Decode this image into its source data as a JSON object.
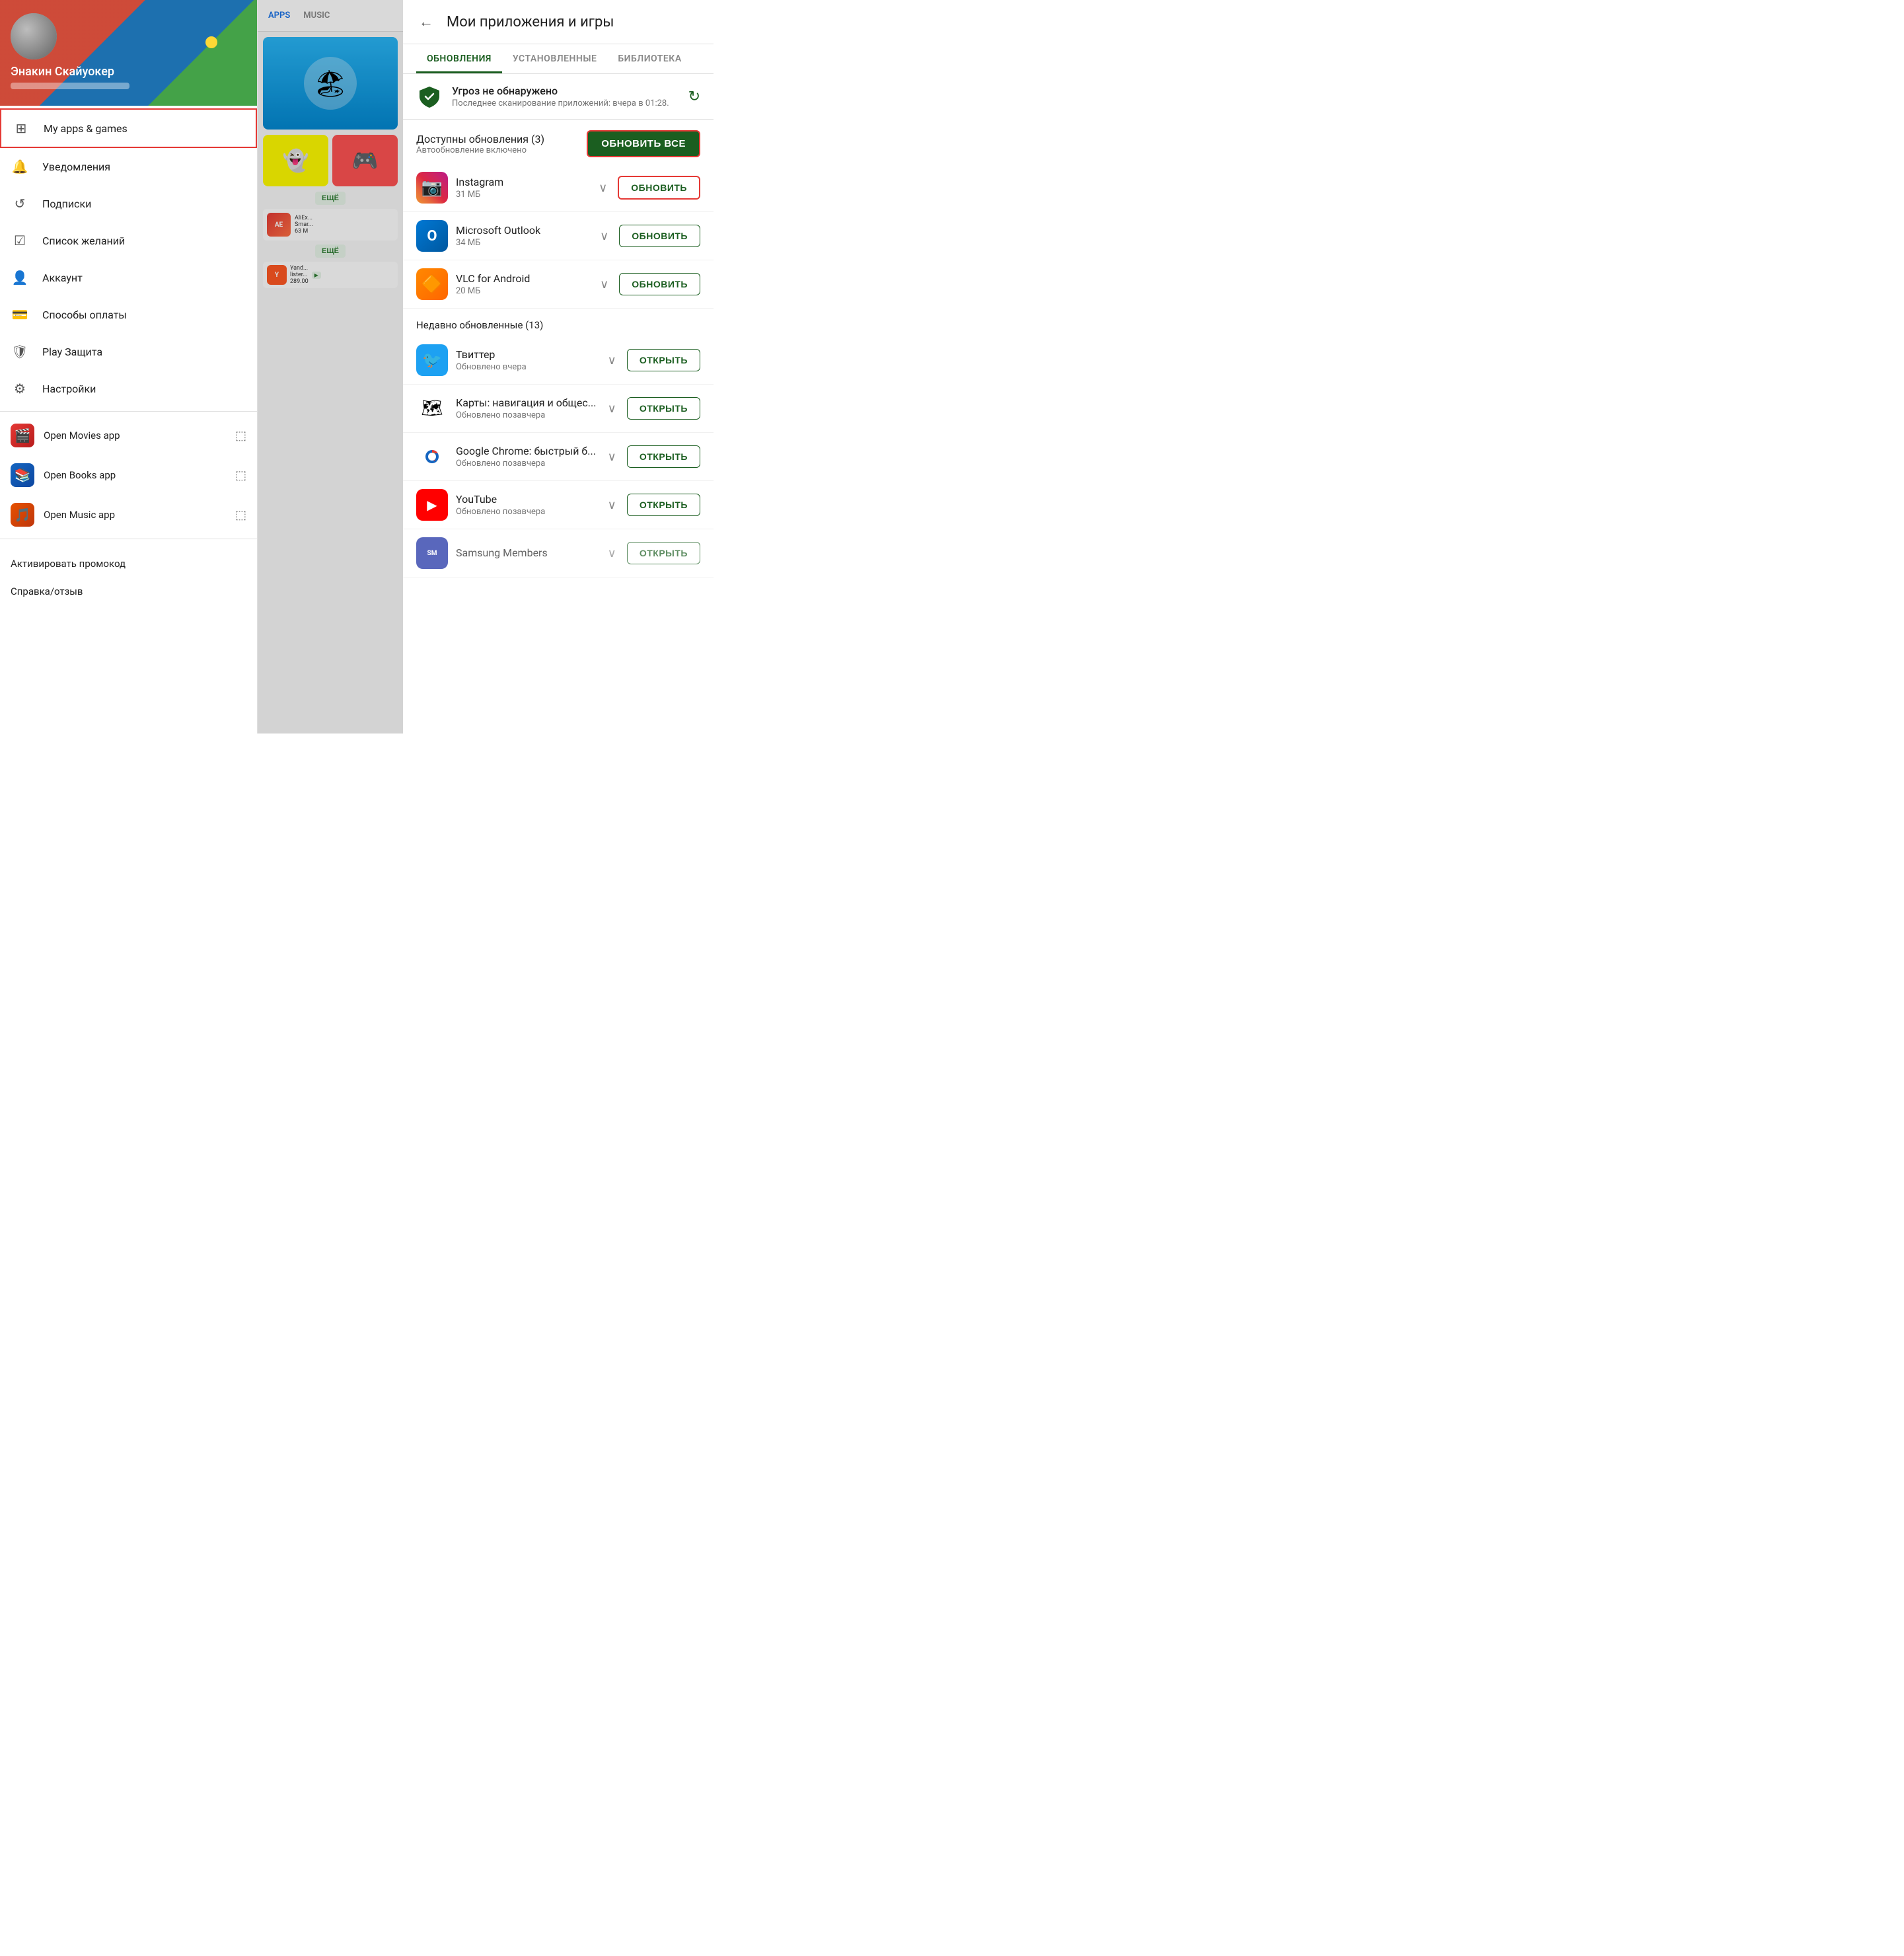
{
  "left": {
    "profile": {
      "name": "Энакин Скайуокер"
    },
    "nav": {
      "my_apps_label": "My apps & games",
      "notifications_label": "Уведомления",
      "subscriptions_label": "Подписки",
      "wishlist_label": "Список желаний",
      "account_label": "Аккаунт",
      "payment_label": "Способы оплаты",
      "play_protect_label": "Play Защита",
      "settings_label": "Настройки"
    },
    "apps": {
      "movies_label": "Open Movies app",
      "books_label": "Open Books app",
      "music_label": "Open Music app"
    },
    "bottom": {
      "promo_label": "Активировать промокод",
      "feedback_label": "Справка/отзыв"
    }
  },
  "middle": {
    "tabs": {
      "apps_label": "APPS",
      "music_label": "MUSIC"
    },
    "esche_label": "ЕЩЁ",
    "aliex": {
      "name": "AliEx...",
      "subtitle": "Smar...",
      "size": "63 M"
    },
    "yand": {
      "name": "Yand...",
      "subtitle": "lister...",
      "price": "289.00",
      "badge": "▶"
    }
  },
  "right": {
    "header": {
      "back_icon": "←",
      "title": "Мои приложения и игры"
    },
    "tabs": [
      {
        "label": "ОБНОВЛЕНИЯ",
        "active": true
      },
      {
        "label": "УСТАНОВЛЕННЫЕ",
        "active": false
      },
      {
        "label": "БИБЛИОТЕКА",
        "active": false
      }
    ],
    "security": {
      "title": "Угроз не обнаружено",
      "subtitle": "Последнее сканирование приложений: вчера в 01:28.",
      "refresh_icon": "↻"
    },
    "updates": {
      "title": "Доступны обновления (3)",
      "subtitle": "Автообновление включено",
      "update_all_label": "ОБНОВИТЬ ВСЕ"
    },
    "update_apps": [
      {
        "name": "Instagram",
        "size": "31 МБ",
        "icon_type": "instagram",
        "button_label": "ОБНОВИТЬ",
        "highlighted": true
      },
      {
        "name": "Microsoft Outlook",
        "size": "34 МБ",
        "icon_type": "outlook",
        "button_label": "ОБНОВИТЬ",
        "highlighted": false
      },
      {
        "name": "VLC for Android",
        "size": "20 МБ",
        "icon_type": "vlc",
        "button_label": "ОБНОВИТЬ",
        "highlighted": false
      }
    ],
    "recently_updated": {
      "title": "Недавно обновленные (13)"
    },
    "recent_apps": [
      {
        "name": "Твиттер",
        "subtitle": "Обновлено вчера",
        "icon_type": "twitter",
        "button_label": "ОТКРЫТЬ"
      },
      {
        "name": "Карты: навигация и общес...",
        "subtitle": "Обновлено позавчера",
        "icon_type": "maps",
        "button_label": "ОТКРЫТЬ"
      },
      {
        "name": "Google Chrome: быстрый б...",
        "subtitle": "Обновлено позавчера",
        "icon_type": "chrome",
        "button_label": "ОТКРЫТЬ"
      },
      {
        "name": "YouTube",
        "subtitle": "Обновлено позавчера",
        "icon_type": "youtube",
        "button_label": "ОТКРЫТЬ"
      },
      {
        "name": "Samsung Members",
        "subtitle": "",
        "icon_type": "samsung",
        "button_label": "ОТКРЫТЬ"
      }
    ]
  }
}
